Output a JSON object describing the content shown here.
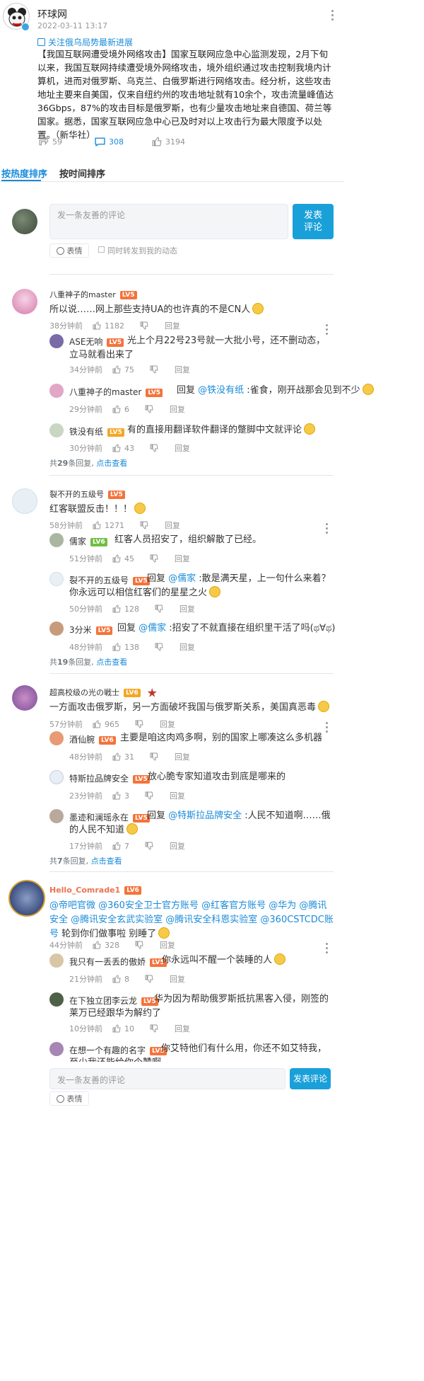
{
  "post": {
    "author": "环球网",
    "time": "2022-03-11 13:17",
    "follow_label": "关注俄乌局势最新进展",
    "text": "【我国互联网遭受境外网络攻击】国家互联网应急中心监测发现，2月下旬以来，我国互联网持续遭受境外网络攻击，境外组织通过攻击控制我境内计算机，进而对俄罗斯、乌克兰、白俄罗斯进行网络攻击。经分析，这些攻击地址主要来自美国，仅来自纽约州的攻击地址就有10余个，攻击流量峰值达36Gbps，87%的攻击目标是俄罗斯，也有少量攻击地址来自德国、荷兰等国家。据悉，国家互联网应急中心已及时对以上攻击行为最大限度予以处置。（新华社）",
    "forwards": "59",
    "comments": "308",
    "likes": "3194"
  },
  "sort_tabs": [
    "按热度排序",
    "按时间排序"
  ],
  "composer": {
    "placeholder": "发一条友善的评论",
    "emoji_label": "表情",
    "forward_label": "同时转发到我的动态",
    "submit_label": "发表\n评论"
  },
  "threads": [
    {
      "user": "八重神子的master",
      "level": "LV5",
      "text": "所以说……网上那些支持UA的也许真的不是CN人",
      "time": "38分钟前",
      "likes": "1182",
      "reply": "回复",
      "replies": [
        {
          "user": "ASE无响",
          "level": "LV5",
          "text": "光上个月22号23号就一大批小号，还不删动态，立马就看出来了",
          "time": "34分钟前",
          "likes": "75"
        },
        {
          "user": "八重神子的master",
          "level": "LV5",
          "prefix": "回复 ",
          "mention": "@铁没有纸",
          "text": " :雀食，刚开战那会见到不少",
          "time": "29分钟前",
          "likes": "6"
        },
        {
          "user": "铁没有纸",
          "level": "LV5",
          "text": "有的直接用翻译软件翻译的蹩脚中文就评论",
          "time": "30分钟前",
          "likes": "43"
        }
      ],
      "summary_pre": "共",
      "summary_num": "29",
      "summary_post": "条回复,",
      "summary_link": "点击查看"
    },
    {
      "user": "裂不开的五级号",
      "level": "LV5",
      "text": "红客联盟反击！！！",
      "time": "58分钟前",
      "likes": "1271",
      "reply": "回复",
      "replies": [
        {
          "user": "儒家",
          "level": "LV6",
          "text": "红客人员招安了，组织解散了已经。",
          "time": "51分钟前",
          "likes": "45"
        },
        {
          "user": "裂不开的五级号",
          "level": "LV5",
          "prefix": "回复 ",
          "mention": "@儒家",
          "text": " :散是满天星，上一句什么来着？你永远可以相信红客们的星星之火",
          "time": "50分钟前",
          "likes": "128"
        },
        {
          "user": "3分米",
          "level": "LV5",
          "prefix": "回复 ",
          "mention": "@儒家",
          "text": " :招安了不就直接在组织里干活了吗(ಥ∀ಥ)",
          "time": "48分钟前",
          "likes": "138"
        }
      ],
      "summary_pre": "共",
      "summary_num": "19",
      "summary_post": "条回复,",
      "summary_link": "点击查看"
    },
    {
      "user": "超高校级の光の戦士",
      "level": "LV6",
      "text": "一方面攻击俄罗斯，另一方面破坏我国与俄罗斯关系，美国真恶毒",
      "time": "57分钟前",
      "likes": "965",
      "reply": "回复",
      "replies": [
        {
          "user": "酒仙腕",
          "level": "LV6",
          "text": "主要是咱这肉鸡多啊，别的国家上哪凑这么多机器",
          "time": "48分钟前",
          "likes": "31"
        },
        {
          "user": "特斯拉品牌安全",
          "level": "LV5",
          "text": "放心脆专家知道攻击到底是哪来的",
          "time": "23分钟前",
          "likes": "3"
        },
        {
          "user": "墨迹和澜瑶永在",
          "level": "LV5",
          "prefix": "回复 ",
          "mention": "@特斯拉品牌安全",
          "text": " :人民不知道啊……俄的人民不知道",
          "time": "17分钟前",
          "likes": "7"
        }
      ],
      "summary_pre": "共",
      "summary_num": "7",
      "summary_post": "条回复,",
      "summary_link": "点击查看"
    },
    {
      "user": "Hello_Comrade1",
      "level": "LV6",
      "mentions": "@帝吧官微 @360安全卫士官方账号 @红客官方账号 @华为 @腾讯安全 @腾讯安全玄武实验室 @腾讯安全科恩实验室 @360CSTCDC账号",
      "text": " 轮到你们做事啦 别睡了",
      "time": "44分钟前",
      "likes": "328",
      "reply": "回复",
      "replies": [
        {
          "user": "我只有一丢丢的傲娇",
          "level": "LV5",
          "text": "你永远叫不醒一个装睡的人",
          "time": "21分钟前",
          "likes": "8"
        },
        {
          "user": "在下独立团李云龙",
          "level": "LV5",
          "text": "华为因为帮助俄罗斯抵抗黑客入侵，刚签的莱万已经跟华为解约了",
          "time": "10分钟前",
          "likes": "10"
        },
        {
          "user": "在想一个有趣的名字",
          "level": "LV5",
          "text": "你艾特他们有什么用，你还不如艾特我，至少我还能给你个赞啊",
          "time": "",
          "likes": ""
        }
      ]
    }
  ],
  "bottom_bar": {
    "placeholder": "发一条友善的评论",
    "submit_label": "发表评论",
    "emoji_label": "表情"
  }
}
